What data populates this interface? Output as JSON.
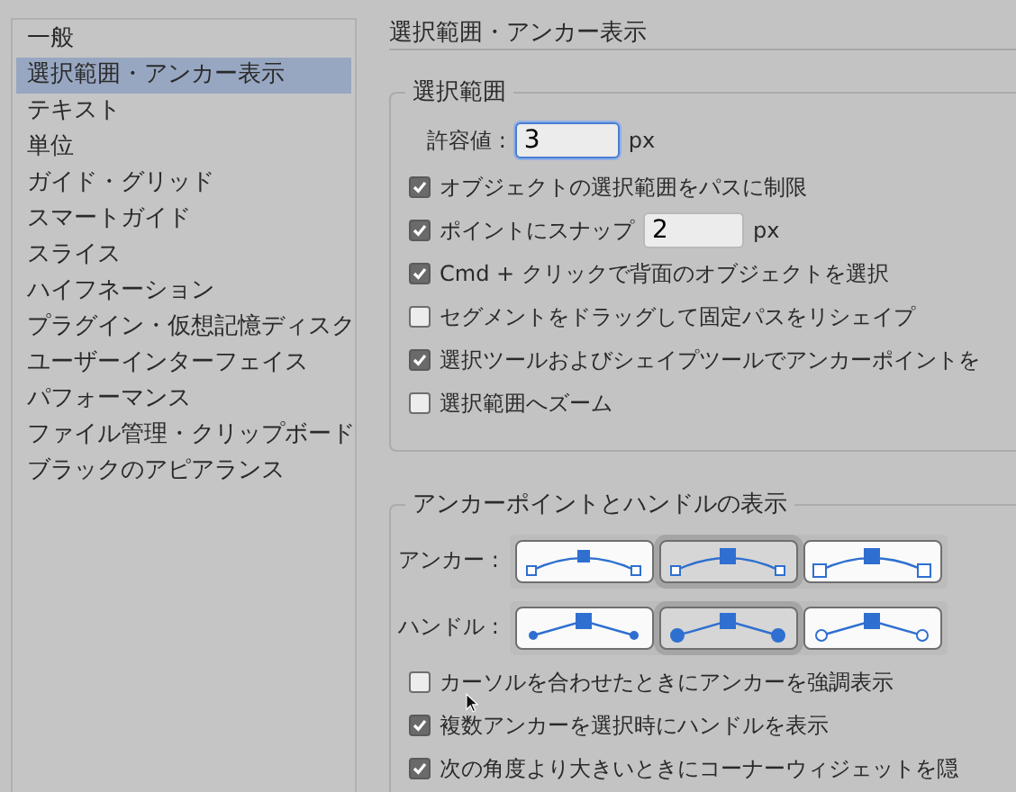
{
  "sidebar": {
    "items": [
      {
        "label": "一般",
        "selected": false
      },
      {
        "label": "選択範囲・アンカー表示",
        "selected": true
      },
      {
        "label": "テキスト",
        "selected": false
      },
      {
        "label": "単位",
        "selected": false
      },
      {
        "label": "ガイド・グリッド",
        "selected": false
      },
      {
        "label": "スマートガイド",
        "selected": false
      },
      {
        "label": "スライス",
        "selected": false
      },
      {
        "label": "ハイフネーション",
        "selected": false
      },
      {
        "label": "プラグイン・仮想記憶ディスク",
        "selected": false
      },
      {
        "label": "ユーザーインターフェイス",
        "selected": false
      },
      {
        "label": "パフォーマンス",
        "selected": false
      },
      {
        "label": "ファイル管理・クリップボード",
        "selected": false
      },
      {
        "label": "ブラックのアピアランス",
        "selected": false
      }
    ]
  },
  "panel": {
    "title": "選択範囲・アンカー表示",
    "selection_group": {
      "title": "選択範囲",
      "tolerance": {
        "label": "許容値 :",
        "value": "3",
        "unit": "px"
      },
      "options": [
        {
          "kind": "checkbox",
          "label": "オブジェクトの選択範囲をパスに制限",
          "checked": true
        },
        {
          "kind": "snap",
          "label": "ポイントにスナップ",
          "checked": true,
          "value": "2",
          "unit": "px"
        },
        {
          "kind": "checkbox",
          "label": "Cmd + クリックで背面のオブジェクトを選択",
          "checked": true
        },
        {
          "kind": "checkbox",
          "label": "セグメントをドラッグして固定パスをリシェイプ",
          "checked": false
        },
        {
          "kind": "checkbox",
          "label": "選択ツールおよびシェイプツールでアンカーポイントを",
          "checked": true
        },
        {
          "kind": "checkbox",
          "label": "選択範囲へズーム",
          "checked": false
        }
      ]
    },
    "anchor_group": {
      "title": "アンカーポイントとハンドルの表示",
      "rows": [
        {
          "label": "アンカー :",
          "kind": "anchor",
          "choices": [
            {
              "kind": "small",
              "selected": false
            },
            {
              "kind": "medium",
              "selected": true
            },
            {
              "kind": "large",
              "selected": false
            }
          ]
        },
        {
          "label": "ハンドル :",
          "kind": "handle",
          "choices": [
            {
              "kind": "small",
              "selected": false
            },
            {
              "kind": "medium",
              "selected": true
            },
            {
              "kind": "hollow",
              "selected": false
            }
          ]
        }
      ],
      "options": [
        {
          "kind": "checkbox",
          "label": "カーソルを合わせたときにアンカーを強調表示",
          "checked": false
        },
        {
          "kind": "checkbox",
          "label": "複数アンカーを選択時にハンドルを表示",
          "checked": true
        },
        {
          "kind": "checkbox",
          "label": "次の角度より大きいときにコーナーウィジェットを隠",
          "checked": true
        }
      ]
    }
  }
}
